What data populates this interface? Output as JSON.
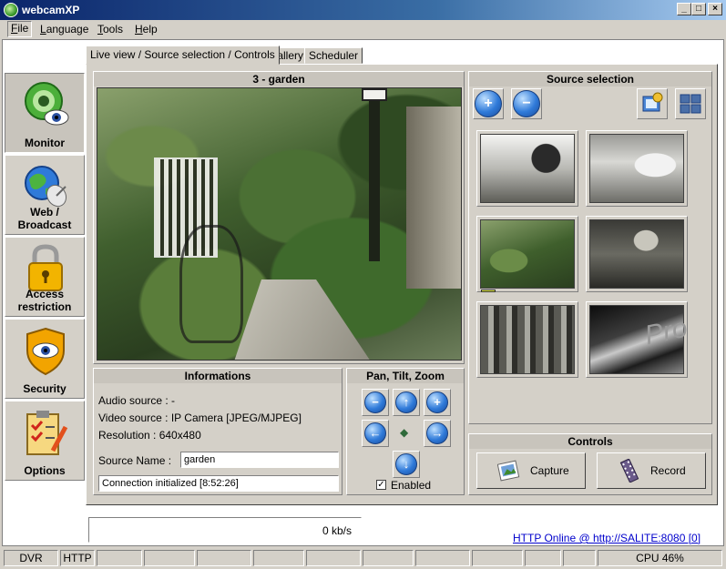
{
  "window": {
    "title": "webcamXP"
  },
  "window_buttons": {
    "minimize": "_",
    "maximize": "□",
    "close": "×"
  },
  "menu": [
    {
      "key": "F",
      "rest": "ile"
    },
    {
      "key": "L",
      "rest": "anguage"
    },
    {
      "key": "T",
      "rest": "ools"
    },
    {
      "key": "H",
      "rest": "elp"
    }
  ],
  "nav": [
    {
      "label": "Monitor"
    },
    {
      "label": "Web / Broadcast"
    },
    {
      "label": "Access restriction"
    },
    {
      "label": "Security"
    },
    {
      "label": "Options"
    }
  ],
  "tabs": [
    {
      "label": "Live view / Source selection / Controls"
    },
    {
      "label": "Gallery"
    },
    {
      "label": "Scheduler"
    }
  ],
  "live": {
    "title": "3 - garden"
  },
  "info": {
    "title": "Informations",
    "audio": "Audio source : -",
    "video": "Video source : IP Camera [JPEG/MJPEG]",
    "resolution": "Resolution : 640x480",
    "source_name_label": "Source Name :",
    "source_name_value": "garden",
    "status": "Connection initialized [8:52:26]"
  },
  "ptz": {
    "title": "Pan, Tilt, Zoom",
    "enabled_label": "Enabled",
    "enabled": true,
    "zoom_out": "−",
    "zoom_in": "+",
    "up": "↑",
    "down": "↓",
    "left": "←",
    "right": "→",
    "center": "◆"
  },
  "sources": {
    "title": "Source selection",
    "add": "+",
    "remove": "−",
    "thumb_6_text": "Pro"
  },
  "controls": {
    "title": "Controls",
    "capture": "Capture",
    "record": "Record"
  },
  "bandwidth": "0 kb/s",
  "http_status": "HTTP Online @ http://SALITE:8080 [0]",
  "status": {
    "dvr": "DVR",
    "http": "HTTP",
    "cpu": "CPU 46%"
  }
}
